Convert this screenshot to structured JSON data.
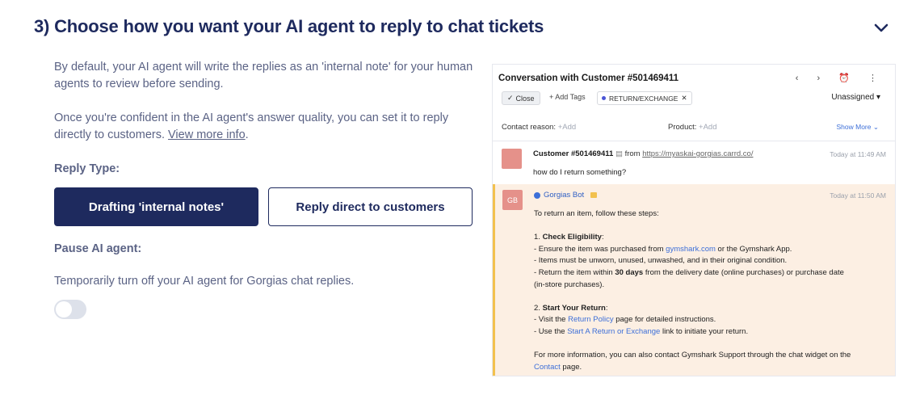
{
  "section": {
    "title": "3) Choose how you want your AI agent to reply to chat tickets",
    "collapse_icon": "chevron-down-icon"
  },
  "intro": {
    "para1": "By default, your AI agent will write the replies as an 'internal note' for your human agents to review before sending.",
    "para2_text": "Once you're confident in the AI agent's answer quality, you can set it to reply directly to customers. ",
    "para2_link": "View more info",
    "para2_end": "."
  },
  "reply_type": {
    "label": "Reply Type:",
    "option_internal": "Drafting 'internal notes'",
    "option_direct": "Reply direct to customers",
    "selected": "Drafting 'internal notes'"
  },
  "pause": {
    "label": "Pause AI agent:",
    "description": "Temporarily turn off your AI agent for Gorgias chat replies.",
    "toggle_on": false
  },
  "preview": {
    "title": "Conversation with Customer #501469411",
    "header_icons": "‹ › ⏰ ⋮",
    "close_label": "Close",
    "add_tags": "+ Add Tags",
    "tag": "RETURN/EXCHANGE",
    "assignee": "Unassigned",
    "contact_reason_label": "Contact reason:",
    "contact_reason_value": "+Add",
    "product_label": "Product:",
    "product_value": "+Add",
    "show_more": "Show More",
    "customer_message": {
      "sender": "Customer #501469411",
      "via": "from",
      "url": "https://myaskai-gorgias.carrd.co/",
      "time": "Today at 11:49 AM",
      "body": "how do I return something?"
    },
    "bot_message": {
      "avatar": "GB",
      "sender": "Gorgias Bot",
      "time": "Today at 11:50 AM",
      "l1": "To return an item, follow these steps:",
      "l2": "1. ",
      "l2b": "Check Eligibility",
      "l2c": ":",
      "l3a": "- Ensure the item was purchased from ",
      "l3link": "gymshark.com",
      "l3b": " or the Gymshark App.",
      "l4": "- Items must be unworn, unused, unwashed, and in their original condition.",
      "l5a": "- Return the item within ",
      "l5b": "30 days",
      "l5c": " from the delivery date (online purchases) or purchase date",
      "l6": "(in-store purchases).",
      "l7": "2. ",
      "l7b": "Start Your Return",
      "l7c": ":",
      "l8a": "- Visit the ",
      "l8link": "Return Policy",
      "l8b": " page for detailed instructions.",
      "l9a": "- Use the ",
      "l9link": "Start A Return or Exchange",
      "l9b": " link to initiate your return.",
      "l10": "For more information, you can also contact Gymshark Support through the chat widget on the",
      "l11link": "Contact",
      "l11b": " page."
    }
  }
}
